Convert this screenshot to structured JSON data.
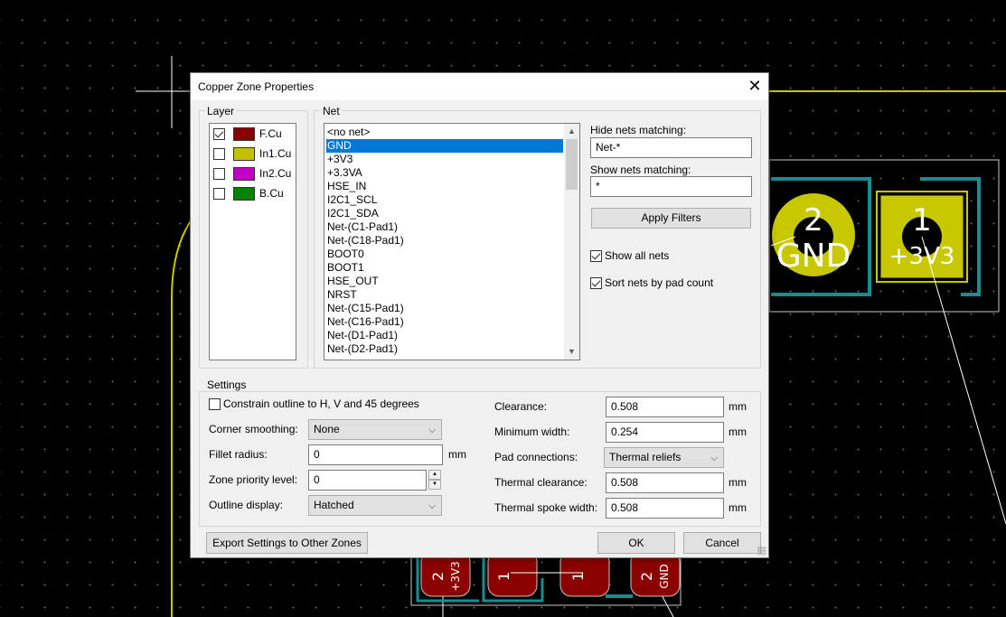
{
  "pcb": {
    "pad2": {
      "number": "2",
      "net": "GND"
    },
    "pad1": {
      "number": "1",
      "net": "+3V3"
    },
    "bottom_pads": [
      {
        "number": "2",
        "net": "+3V3"
      },
      {
        "number": "1",
        "net": ""
      },
      {
        "number": "1",
        "net": ""
      },
      {
        "number": "2",
        "net": "GND"
      }
    ]
  },
  "dialog": {
    "title": "Copper Zone Properties",
    "close_glyph": "✕"
  },
  "layer_group": {
    "label": "Layer",
    "layers": [
      {
        "name": "F.Cu",
        "checked": true,
        "color": "#8b0000"
      },
      {
        "name": "In1.Cu",
        "checked": false,
        "color": "#c2c200"
      },
      {
        "name": "In2.Cu",
        "checked": false,
        "color": "#c200c2"
      },
      {
        "name": "B.Cu",
        "checked": false,
        "color": "#008400"
      }
    ]
  },
  "net_group": {
    "label": "Net",
    "nets": [
      "<no net>",
      "GND",
      "+3V3",
      "+3.3VA",
      "HSE_IN",
      "I2C1_SCL",
      "I2C1_SDA",
      "Net-(C1-Pad1)",
      "Net-(C18-Pad1)",
      "BOOT0",
      "BOOT1",
      "HSE_OUT",
      "NRST",
      "Net-(C15-Pad1)",
      "Net-(C16-Pad1)",
      "Net-(D1-Pad1)",
      "Net-(D2-Pad1)"
    ],
    "selected": "GND",
    "hide_label": "Hide nets matching:",
    "hide_value": "Net-*",
    "show_label": "Show nets matching:",
    "show_value": "*",
    "apply_label": "Apply Filters",
    "show_all_label": "Show all nets",
    "show_all_checked": true,
    "sort_label": "Sort nets by pad count",
    "sort_checked": true
  },
  "settings": {
    "label": "Settings",
    "constrain_label": "Constrain outline to H, V and 45 degrees",
    "constrain_checked": false,
    "corner_label": "Corner smoothing:",
    "corner_value": "None",
    "fillet_label": "Fillet radius:",
    "fillet_value": "0",
    "fillet_unit": "mm",
    "priority_label": "Zone priority level:",
    "priority_value": "0",
    "outline_label": "Outline display:",
    "outline_value": "Hatched",
    "clearance_label": "Clearance:",
    "clearance_value": "0.508",
    "clearance_unit": "mm",
    "minwidth_label": "Minimum width:",
    "minwidth_value": "0.254",
    "minwidth_unit": "mm",
    "pad_label": "Pad connections:",
    "pad_value": "Thermal reliefs",
    "thermal_clear_label": "Thermal clearance:",
    "thermal_clear_value": "0.508",
    "thermal_clear_unit": "mm",
    "spoke_label": "Thermal spoke width:",
    "spoke_value": "0.508",
    "spoke_unit": "mm"
  },
  "footer": {
    "export_label": "Export Settings to Other Zones",
    "ok_label": "OK",
    "cancel_label": "Cancel"
  }
}
